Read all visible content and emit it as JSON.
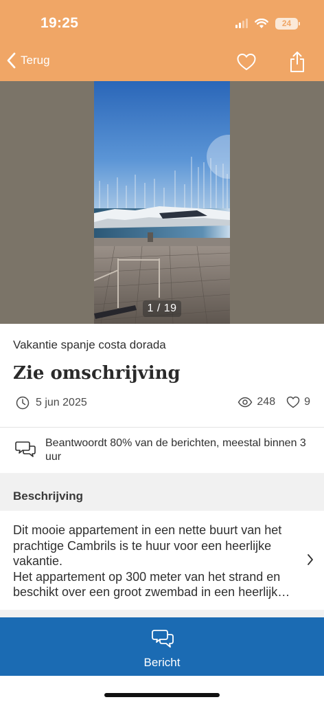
{
  "status_bar": {
    "time": "19:25",
    "battery": "24"
  },
  "nav": {
    "back_label": "Terug"
  },
  "gallery": {
    "counter": "1 / 19"
  },
  "listing": {
    "category": "Vakantie spanje costa dorada",
    "title": "Zie omschrijving",
    "date": "5 jun 2025",
    "views": "248",
    "favorites": "9"
  },
  "response": {
    "text": "Beantwoordt 80% van de berichten, meestal binnen 3 uur"
  },
  "description": {
    "heading": "Beschrijving",
    "text": "Dit mooie appartement in een nette buurt van het prachtige Cambrils is te huur voor een heerlijke vakantie.\nHet appartement op 300 meter van het strand en beschikt over een groot zwembad in een heerlijk…"
  },
  "actions": {
    "message_label": "Bericht"
  },
  "colors": {
    "header": "#f0a666",
    "primary": "#1b6bb3",
    "gallery_bg": "#7b7468"
  }
}
